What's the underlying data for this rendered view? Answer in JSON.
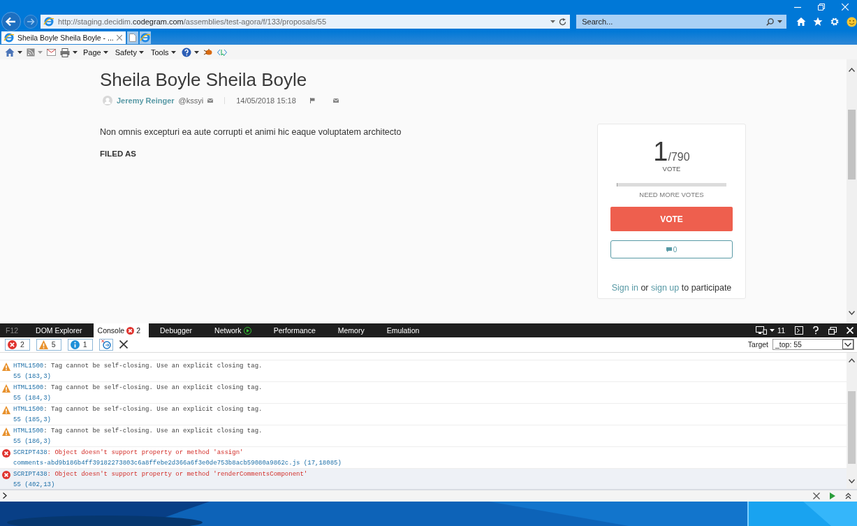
{
  "browser": {
    "url": "http://staging.decidim.**codegram.com**/assemblies/test-agora/f/133/proposals/55",
    "search": {
      "placeholder": "Search..."
    },
    "tabs": [
      {
        "label": "Sheila Boyle Sheila Boyle - ...",
        "selected": true
      }
    ],
    "command_bar": [
      "Page",
      "Safety",
      "Tools"
    ]
  },
  "proposal": {
    "title": "Sheila Boyle Sheila Boyle",
    "author": "Jeremy Reinger",
    "nickname": "@kssyi",
    "date": "14/05/2018 15:18",
    "body": "Non omnis excepturi ea aute corrupti et animi hic eaque voluptatem architecto",
    "filed_as": "FILED AS"
  },
  "vote_card": {
    "count": "1",
    "total": "/790",
    "unit": "VOTE",
    "level": 0.0013,
    "progress_label": "NEED MORE VOTES",
    "vote_button": "VOTE",
    "comments_count": "0",
    "sign_in": "Sign in",
    "or": "or",
    "sign_up": "sign up",
    "participate": "to participate"
  },
  "devtools": {
    "f12": "F12",
    "tabs": [
      {
        "label": "DOM Explorer",
        "selected": false
      },
      {
        "label": "Console",
        "selected": true,
        "badge": "2"
      },
      {
        "label": "Debugger",
        "selected": false
      },
      {
        "label": "Network",
        "selected": false,
        "kind": "network"
      },
      {
        "label": "Performance",
        "selected": false
      },
      {
        "label": "Memory",
        "selected": false
      },
      {
        "label": "Emulation",
        "selected": false
      }
    ],
    "version": "11",
    "filters": [
      {
        "kind": "error",
        "count": "2"
      },
      {
        "kind": "warning",
        "count": "5"
      },
      {
        "kind": "info",
        "count": "1"
      }
    ],
    "target_label": "Target",
    "target_value": "_top: 55",
    "messages": [
      {
        "kind": "warning",
        "code": "HTML1500",
        "text": ": Tag cannot be self-closing. Use an explicit closing tag.",
        "source": "55 (183,3)",
        "selected": false
      },
      {
        "kind": "warning",
        "code": "HTML1500",
        "text": ": Tag cannot be self-closing. Use an explicit closing tag.",
        "source": "55 (184,3)",
        "selected": false
      },
      {
        "kind": "warning",
        "code": "HTML1500",
        "text": ": Tag cannot be self-closing. Use an explicit closing tag.",
        "source": "55 (185,3)",
        "selected": false
      },
      {
        "kind": "warning",
        "code": "HTML1500",
        "text": ": Tag cannot be self-closing. Use an explicit closing tag.",
        "source": "55 (186,3)",
        "selected": false
      },
      {
        "kind": "error",
        "code": "SCRIPT438",
        "text": ": Object doesn't support property or method 'assign'",
        "source": "comments-abd9b186b4ff39182273803c6a8ffebe2d366a6f3e0de753b8acb59080a9862c.js (17,18085)",
        "selected": false
      },
      {
        "kind": "error",
        "code": "SCRIPT438",
        "text": ": Object doesn't support property or method 'renderCommentsComponent'",
        "source": "55 (402,13)",
        "selected": true
      }
    ]
  }
}
